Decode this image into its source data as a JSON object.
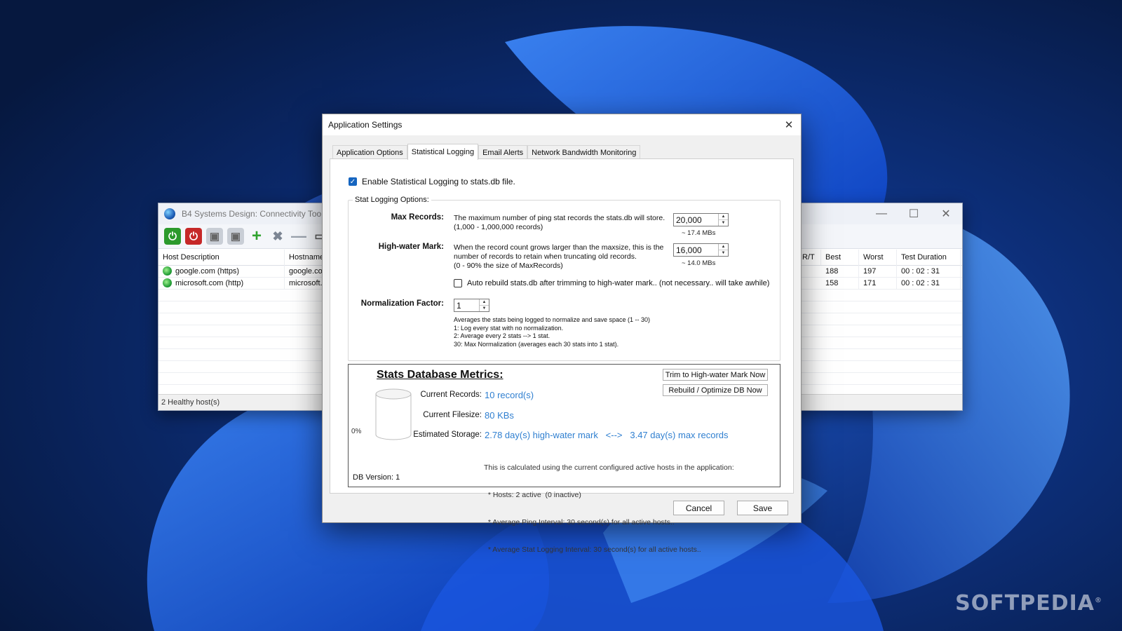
{
  "colors": {
    "desktop_bg": "#0b2a6e",
    "accent": "#1565c0",
    "metric_value": "#2f7fd0"
  },
  "watermark": "SOFTPEDIA",
  "background_window": {
    "title": "B4 Systems Design:  Connectivity Tooll",
    "status": "2 Healthy host(s)",
    "toolbar_icons": [
      "power-on-icon",
      "power-off-icon",
      "move-up-icon",
      "move-down-icon",
      "add-icon",
      "tools-icon",
      "remove-icon",
      "monitor-icon"
    ],
    "columns_left": [
      "Host Description",
      "Hostname"
    ],
    "columns_right": [
      "R/T",
      "Best",
      "Worst",
      "Test Duration"
    ],
    "rows": [
      {
        "description": "google.com (https)",
        "hostname": "google.co",
        "best": "188",
        "worst": "197",
        "duration": "00 : 02 : 31"
      },
      {
        "description": "microsoft.com (http)",
        "hostname": "microsoft.",
        "best": "158",
        "worst": "171",
        "duration": "00 : 02 : 31"
      }
    ]
  },
  "dialog": {
    "title": "Application Settings",
    "tabs": [
      "Application Options",
      "Statistical Logging",
      "Email Alerts",
      "Network Bandwidth Monitoring"
    ],
    "active_tab": "Statistical Logging",
    "enable_logging": {
      "label": "Enable Statistical Logging to stats.db file.",
      "checked": true
    },
    "group_title": "Stat Logging Options:",
    "max_records": {
      "label": "Max Records:",
      "desc1": "The maximum number of ping stat records the stats.db will store.",
      "desc2": "(1,000 - 1,000,000 records)",
      "value": "20,000",
      "size": "~ 17.4 MBs"
    },
    "high_water": {
      "label": "High-water Mark:",
      "desc1": "When the record count grows larger than the maxsize, this is the",
      "desc2": "number of records to retain when truncating old records.",
      "desc3": "(0 - 90% the size of MaxRecords)",
      "value": "16,000",
      "size": "~ 14.0 MBs"
    },
    "auto_rebuild": {
      "label": "Auto rebuild stats.db after trimming to high-water mark.. (not necessary.. will take awhile)",
      "checked": false
    },
    "normalization": {
      "label": "Normalization Factor:",
      "value": "1",
      "lines": [
        "Averages the stats being logged to normalize and save space (1 -- 30)",
        "1: Log every stat with no normalization.",
        "2: Average every 2 stats --> 1 stat.",
        "30: Max Normalization (averages each 30 stats into 1 stat)."
      ]
    },
    "metrics": {
      "title": "Stats Database Metrics:",
      "trim_button": "Trim to High-water Mark Now",
      "rebuild_button": "Rebuild / Optimize DB Now",
      "current_records_label": "Current Records:",
      "current_records": "10 record(s)",
      "current_filesize_label": "Current Filesize:",
      "current_filesize": "80 KBs",
      "estimated_storage_label": "Estimated Storage:",
      "estimated_storage": "2.78 day(s) high-water mark   <-->   3.47 day(s) max records",
      "fill_percent_label": "0%",
      "fill_fraction": 0,
      "notes": [
        "This is calculated using the current configured active hosts in the application:",
        "  * Hosts: 2 active  (0 inactive)",
        "  * Average Ping Interval: 30 second(s) for all active hosts..",
        "  * Average Stat Logging Interval: 30 second(s) for all active hosts.."
      ],
      "db_version": "DB Version: 1"
    },
    "cancel": "Cancel",
    "save": "Save"
  }
}
